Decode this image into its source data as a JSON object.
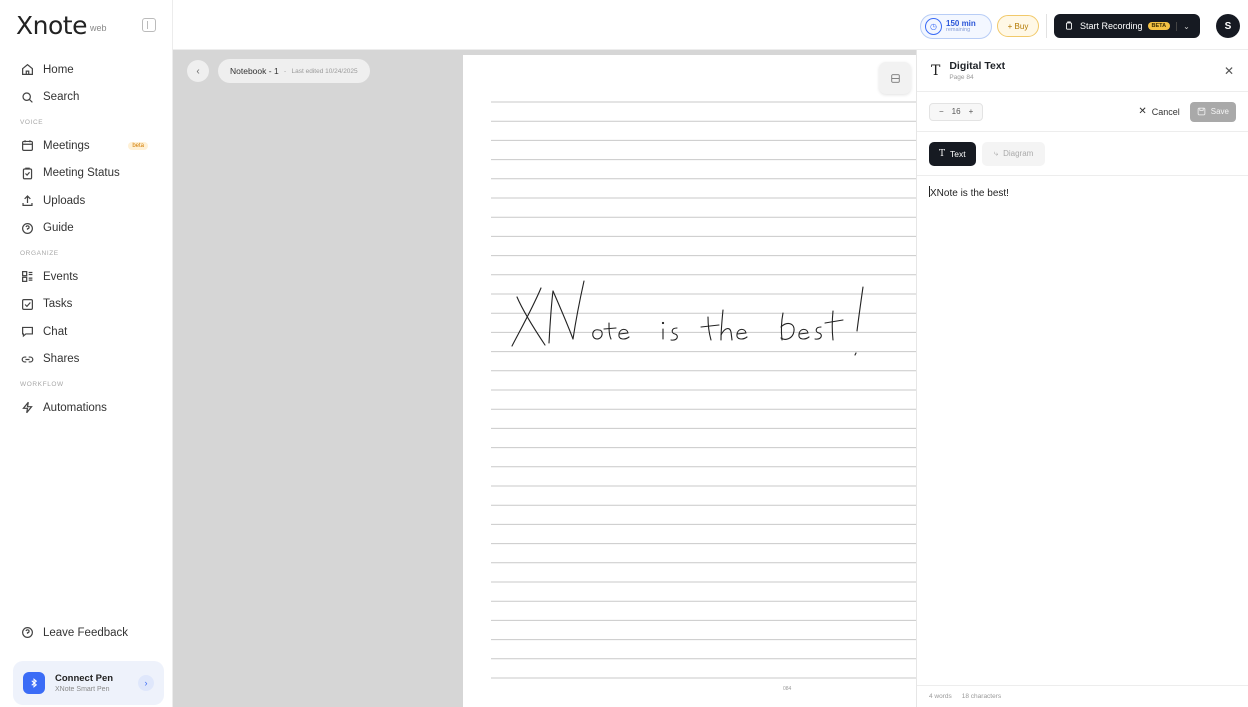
{
  "app": {
    "logo": "Xnote",
    "logo_sub": "web"
  },
  "sidebar": {
    "items": [
      {
        "label": "Home",
        "icon": "home-icon"
      },
      {
        "label": "Search",
        "icon": "search-icon"
      }
    ],
    "voice_label": "VOICE",
    "voice_items": [
      {
        "label": "Meetings",
        "icon": "calendar-icon",
        "badge": "beta"
      },
      {
        "label": "Meeting Status",
        "icon": "clipboard-icon"
      },
      {
        "label": "Uploads",
        "icon": "upload-icon"
      },
      {
        "label": "Guide",
        "icon": "help-icon"
      }
    ],
    "organize_label": "ORGANIZE",
    "organize_items": [
      {
        "label": "Events",
        "icon": "events-icon"
      },
      {
        "label": "Tasks",
        "icon": "tasks-icon"
      },
      {
        "label": "Chat",
        "icon": "chat-icon"
      },
      {
        "label": "Shares",
        "icon": "link-icon"
      }
    ],
    "workflow_label": "WORKFLOW",
    "workflow_items": [
      {
        "label": "Automations",
        "icon": "bolt-icon"
      }
    ],
    "feedback": "Leave Feedback",
    "connect_title": "Connect Pen",
    "connect_sub": "XNote Smart Pen"
  },
  "topbar": {
    "minutes": "150 min",
    "minutes_sub": "remaining",
    "buy": "+ Buy",
    "record": "Start Recording",
    "record_badge": "BETA",
    "avatar": "S",
    "accent": "#3b6cf6"
  },
  "notebook": {
    "title": "Notebook - 1",
    "edited": "Last edited 10/24/2025",
    "handwriting": "XNote is the best!",
    "page_number": "084"
  },
  "panel": {
    "title": "Digital Text",
    "subtitle": "Page 84",
    "font_size": "16",
    "cancel": "Cancel",
    "save": "Save",
    "tab_text": "Text",
    "tab_diagram": "Diagram",
    "content": "XNote is the best!",
    "words": "4 words",
    "chars": "18 characters"
  }
}
